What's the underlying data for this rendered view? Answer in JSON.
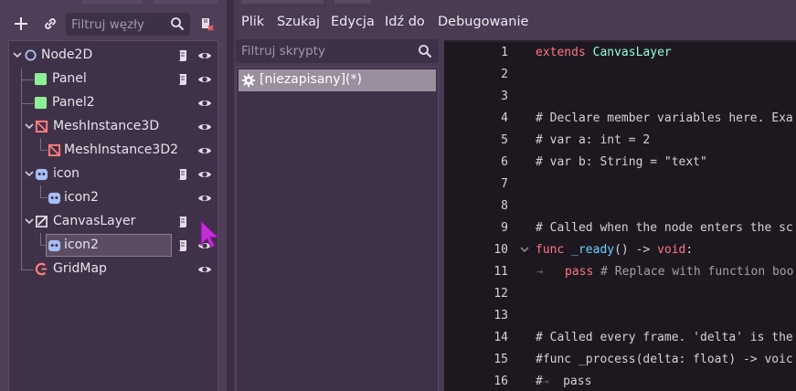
{
  "scene_dock": {
    "filter_placeholder": "Filtruj węzły",
    "tree": [
      {
        "label": "Node2D",
        "icon": "node2d-icon",
        "has_script": true,
        "expandable": true
      },
      {
        "label": "Panel",
        "icon": "panel-icon",
        "has_script": true,
        "expandable": false
      },
      {
        "label": "Panel2",
        "icon": "panel-icon",
        "has_script": false,
        "expandable": false
      },
      {
        "label": "MeshInstance3D",
        "icon": "meshinstance3d-icon",
        "has_script": false,
        "expandable": true
      },
      {
        "label": "MeshInstance3D2",
        "icon": "meshinstance3d-icon",
        "has_script": false,
        "expandable": false
      },
      {
        "label": "icon",
        "icon": "sprite2d-icon",
        "has_script": true,
        "expandable": true
      },
      {
        "label": "icon2",
        "icon": "sprite2d-icon",
        "has_script": false,
        "expandable": false
      },
      {
        "label": "CanvasLayer",
        "icon": "canvaslayer-icon",
        "has_script": true,
        "expandable": true
      },
      {
        "label": "icon2",
        "icon": "sprite2d-icon",
        "has_script": true,
        "expandable": false,
        "selected": true
      },
      {
        "label": "GridMap",
        "icon": "gridmap-icon",
        "has_script": false,
        "expandable": false
      }
    ]
  },
  "menu": {
    "file": "Plik",
    "search": "Szukaj",
    "edit": "Edycja",
    "goto": "Idź do",
    "debug": "Debugowanie"
  },
  "script_panel": {
    "filter_placeholder": "Filtruj skrypty",
    "scripts": [
      {
        "label": "[niezapisany](*)",
        "icon": "gear-icon",
        "selected": true
      }
    ]
  },
  "code": {
    "line_numbers": [
      "1",
      "2",
      "3",
      "4",
      "5",
      "6",
      "7",
      "8",
      "9",
      "10",
      "11",
      "12",
      "13",
      "14",
      "15",
      "16"
    ],
    "lines": [
      "extends CanvasLayer",
      "",
      "",
      "# Declare member variables here. Exa",
      "# var a: int = 2",
      "# var b: String = \"text\"",
      "",
      "",
      "# Called when the node enters the sc",
      "func _ready() -> void:",
      "\tpass # Replace with function boo",
      "",
      "",
      "# Called every frame. 'delta' is the",
      "#func _process(delta: float) -> voic",
      "#\tpass"
    ]
  },
  "colors": {
    "panel_bg": "#4f3e57",
    "tree_bg": "#3f3147",
    "editor_bg": "#1d1820",
    "keyword": "#ff7485",
    "class_name": "#8fffdb",
    "comment": "#a59ea9",
    "function": "#67d3ff",
    "string": "#fde48c",
    "cursor": "#c030d8"
  }
}
